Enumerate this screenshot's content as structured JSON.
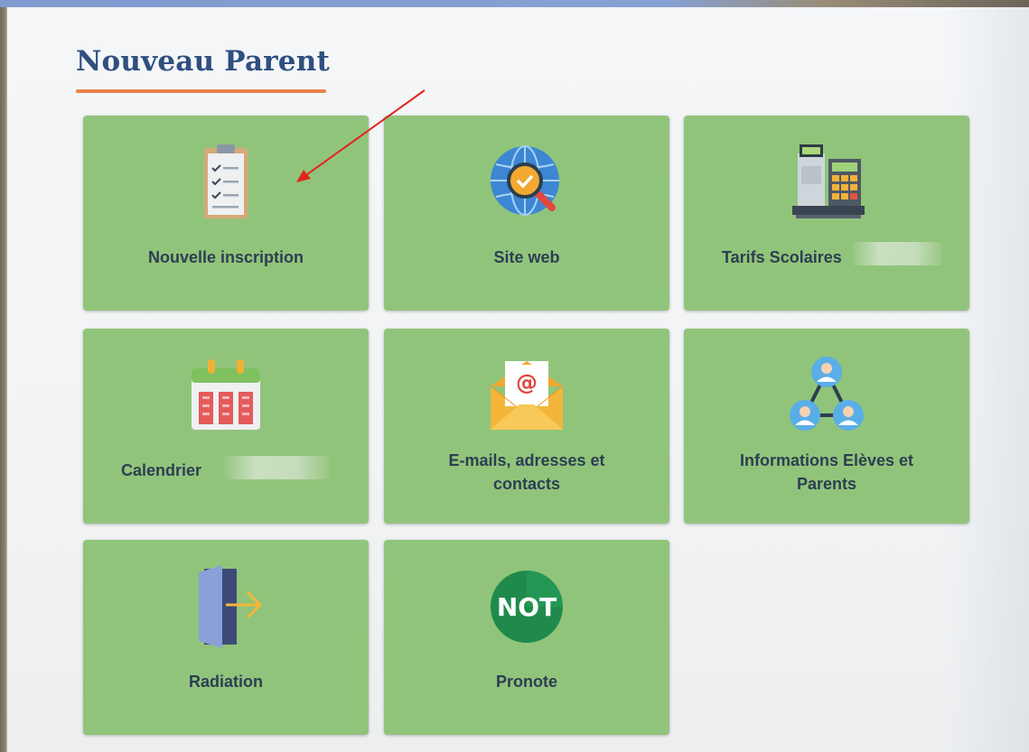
{
  "page": {
    "title": "Nouveau Parent",
    "accent_color": "#e8834a",
    "tile_color": "#91c47b",
    "title_color": "#2f4f7f"
  },
  "tiles": [
    {
      "label": "Nouvelle inscription",
      "icon": "clipboard-checklist-icon"
    },
    {
      "label": "Site web",
      "icon": "globe-magnifier-icon"
    },
    {
      "label": "Tarifs Scolaires",
      "icon": "cash-register-icon"
    },
    {
      "label": "Calendrier",
      "icon": "calendar-icon"
    },
    {
      "label": "E-mails, adresses et contacts",
      "icon": "email-envelope-icon"
    },
    {
      "label": "Informations Elèves et Parents",
      "icon": "people-network-icon"
    },
    {
      "label": "Radiation",
      "icon": "exit-door-icon"
    },
    {
      "label": "Pronote",
      "icon": "pronote-not-logo-icon",
      "logo_text": "NOT"
    }
  ],
  "annotation": {
    "arrow_color": "#e0261b"
  }
}
